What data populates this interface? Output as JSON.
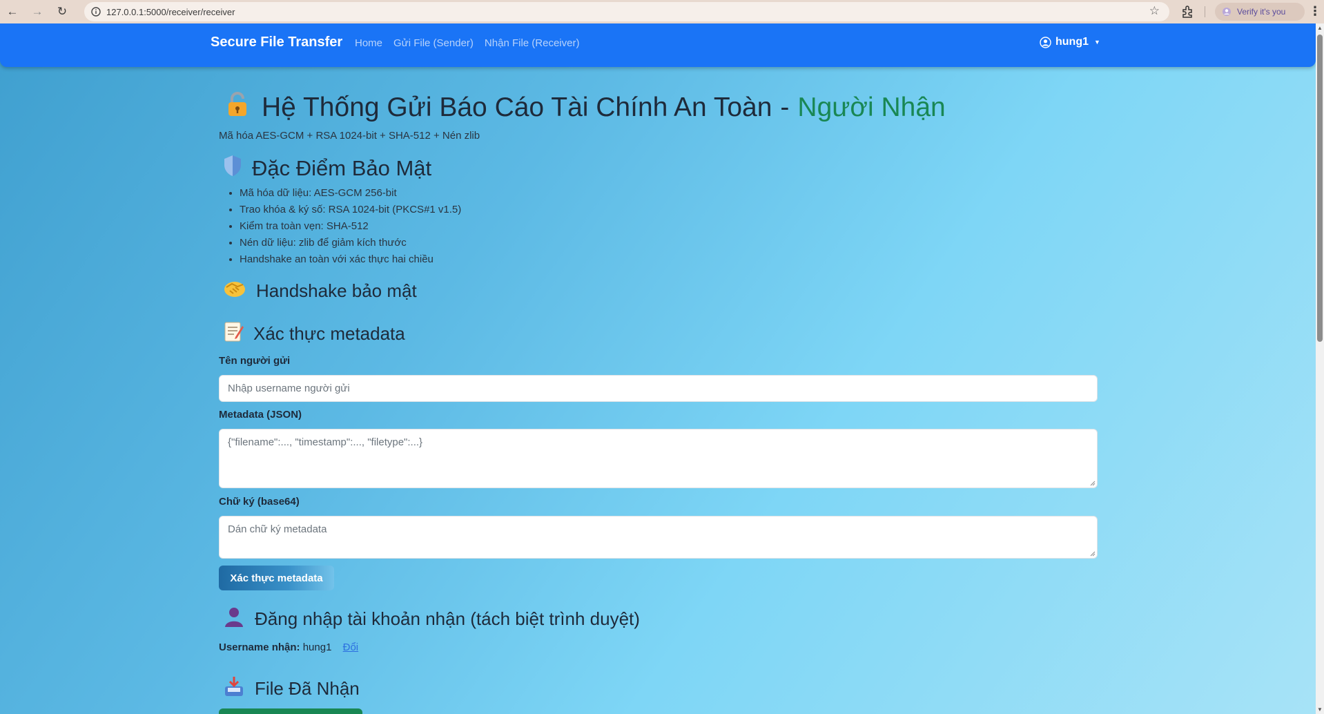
{
  "browser": {
    "url": "127.0.0.1:5000/receiver/receiver",
    "verify_label": "Verify it's you"
  },
  "navbar": {
    "brand": "Secure File Transfer",
    "links": [
      "Home",
      "Gửi File (Sender)",
      "Nhận File (Receiver)"
    ],
    "user": "hung1"
  },
  "header": {
    "title": "Hệ Thống Gửi Báo Cáo Tài Chính An Toàn",
    "dash": "-",
    "title_accent": "Người Nhận",
    "subtitle": "Mã hóa AES-GCM + RSA 1024-bit + SHA-512 + Nén zlib"
  },
  "security": {
    "heading": "Đặc Điểm Bảo Mật",
    "items": [
      "Mã hóa dữ liệu: AES-GCM 256-bit",
      "Trao khóa & ký số: RSA 1024-bit (PKCS#1 v1.5)",
      "Kiểm tra toàn vẹn: SHA-512",
      "Nén dữ liệu: zlib để giảm kích thước",
      "Handshake an toàn với xác thực hai chiều"
    ]
  },
  "handshake": {
    "heading": "Handshake bảo mật"
  },
  "metadata": {
    "heading": "Xác thực metadata",
    "sender_label": "Tên người gửi",
    "sender_placeholder": "Nhập username người gửi",
    "json_label": "Metadata (JSON)",
    "json_placeholder": "{\"filename\":..., \"timestamp\":..., \"filetype\":...}",
    "sig_label": "Chữ ký (base64)",
    "sig_placeholder": "Dán chữ ký metadata",
    "button": "Xác thực metadata"
  },
  "login": {
    "heading": "Đăng nhập tài khoản nhận (tách biệt trình duyệt)",
    "username_label": "Username nhận:",
    "username": "hung1",
    "change_link": "Đổi"
  },
  "received": {
    "heading": "File Đã Nhận"
  },
  "colors": {
    "navbar": "#1a74f6",
    "accent": "#198754",
    "link": "#2c6fe0"
  }
}
